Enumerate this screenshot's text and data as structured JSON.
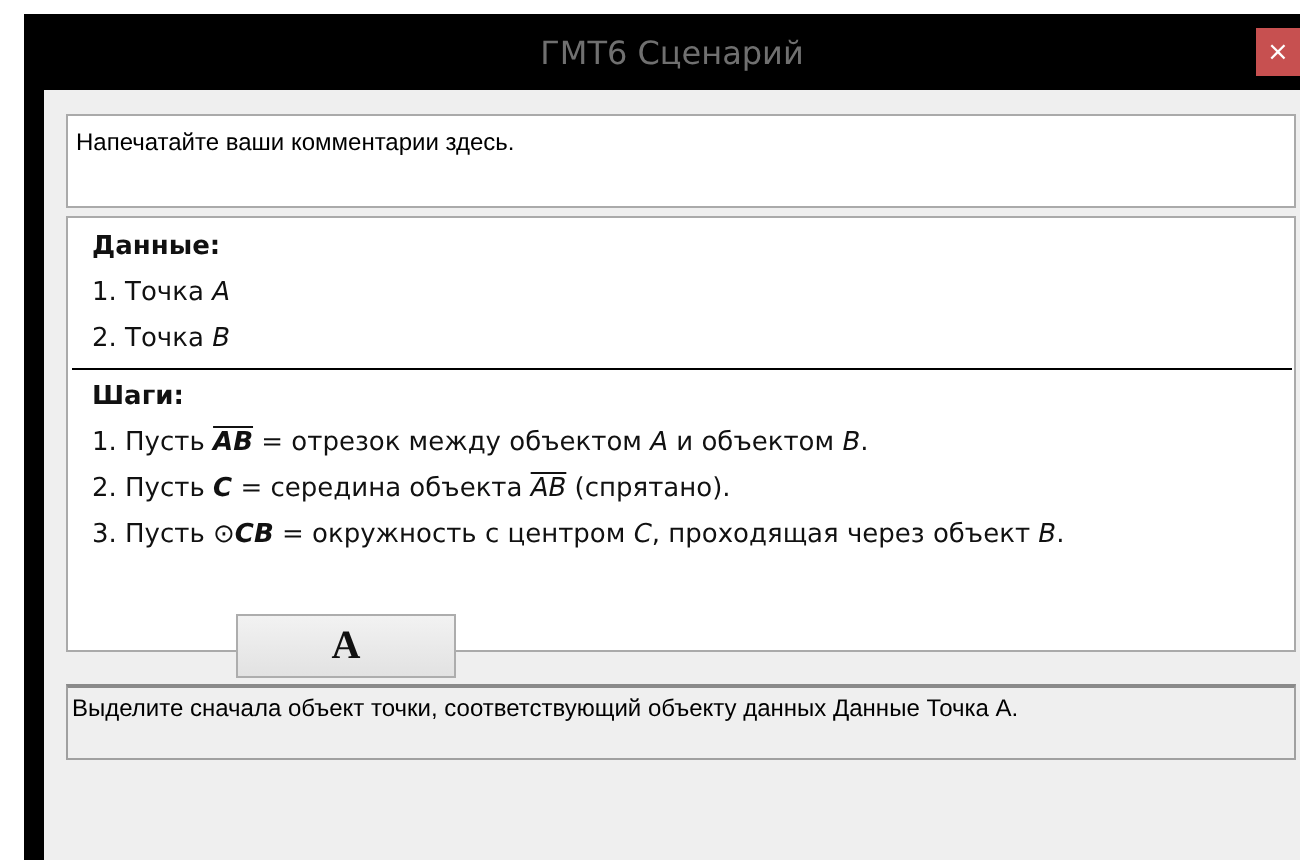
{
  "window": {
    "title": "ГМТ6 Сценарий",
    "close": "×"
  },
  "comment": {
    "placeholder": "Напечатайте ваши комментарии здесь."
  },
  "script": {
    "given": {
      "heading": "Данные:",
      "items": [
        [
          {
            "kind": "text",
            "text": "1. Точка "
          },
          {
            "kind": "var",
            "text": "A"
          }
        ],
        [
          {
            "kind": "text",
            "text": "2. Точка "
          },
          {
            "kind": "var",
            "text": "B"
          }
        ]
      ]
    },
    "steps": {
      "heading": "Шаги:",
      "items": [
        [
          {
            "kind": "text",
            "text": "1. Пусть "
          },
          {
            "kind": "bseg",
            "text": "AB"
          },
          {
            "kind": "text",
            "text": " = отрезок между объектом "
          },
          {
            "kind": "var",
            "text": "A"
          },
          {
            "kind": "text",
            "text": " и объектом "
          },
          {
            "kind": "var",
            "text": "B"
          },
          {
            "kind": "text",
            "text": "."
          }
        ],
        [
          {
            "kind": "text",
            "text": "2. Пусть "
          },
          {
            "kind": "bvar",
            "text": "C"
          },
          {
            "kind": "text",
            "text": " = середина объекта "
          },
          {
            "kind": "seg",
            "text": "AB"
          },
          {
            "kind": "text",
            "text": " (спрятано)."
          }
        ],
        [
          {
            "kind": "text",
            "text": "3. Пусть ⊙"
          },
          {
            "kind": "bvar",
            "text": "CB"
          },
          {
            "kind": "text",
            "text": " = окружность с центром "
          },
          {
            "kind": "var",
            "text": "C"
          },
          {
            "kind": "text",
            "text": ", проходящая через объект "
          },
          {
            "kind": "var",
            "text": "B"
          },
          {
            "kind": "text",
            "text": "."
          }
        ]
      ]
    }
  },
  "font_button": {
    "label": "A"
  },
  "status": "Выделите сначала объект точки, соответствующий объекту данных Данные Точка A."
}
